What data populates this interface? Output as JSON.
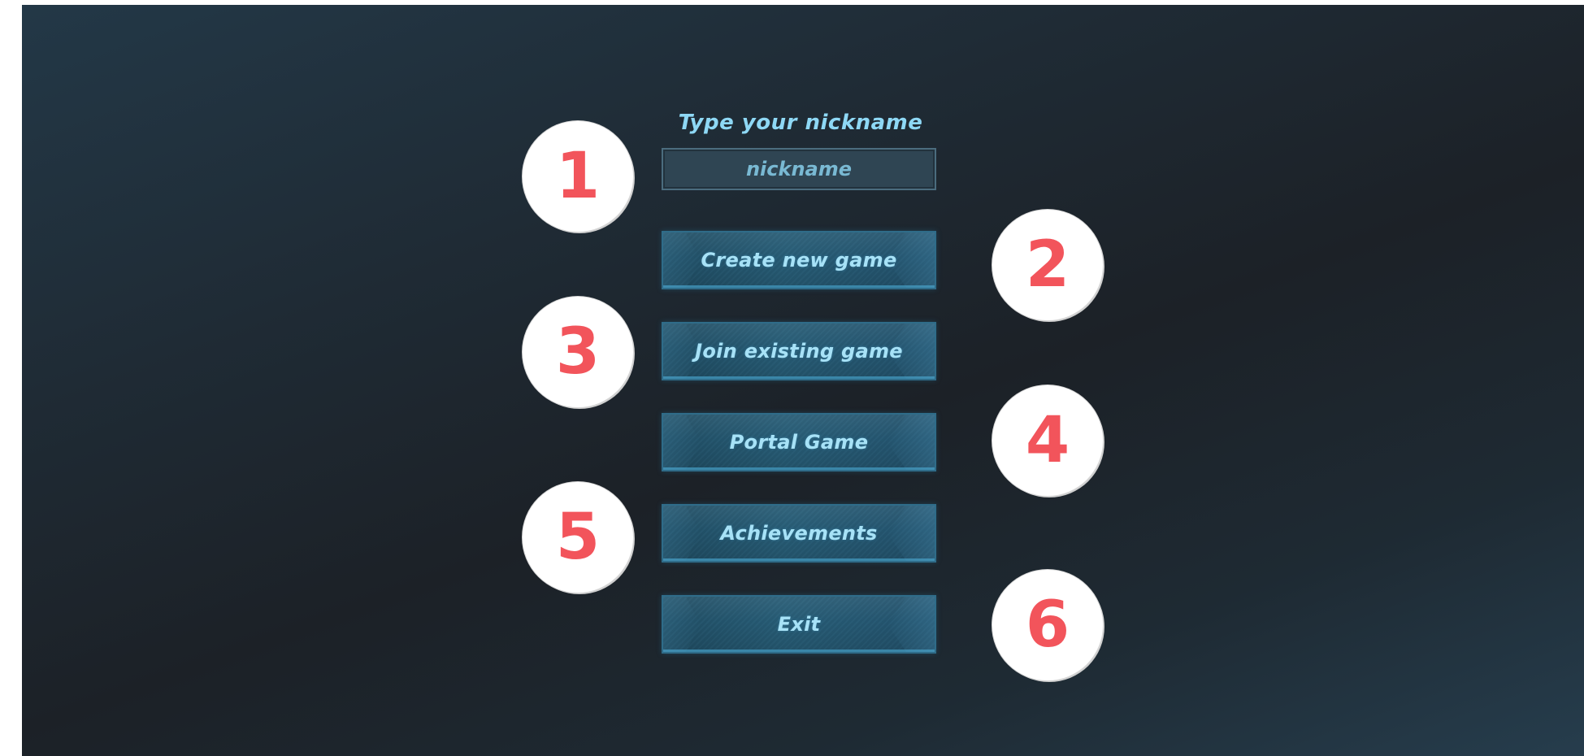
{
  "menu": {
    "title": "Type your nickname",
    "nickname_placeholder": "nickname",
    "buttons": [
      {
        "label": "Create new game"
      },
      {
        "label": "Join existing game"
      },
      {
        "label": "Portal Game"
      },
      {
        "label": "Achievements"
      },
      {
        "label": "Exit"
      }
    ]
  },
  "markers": [
    "1",
    "2",
    "3",
    "4",
    "5",
    "6"
  ],
  "colors": {
    "background_dark": "#1c2127",
    "background_teal": "#263d4d",
    "button_fill": "#265a73",
    "button_border": "#2f6c89",
    "label_text": "#a7e2f7",
    "marker_circle": "#ffffff",
    "marker_digit": "#f2545b"
  }
}
